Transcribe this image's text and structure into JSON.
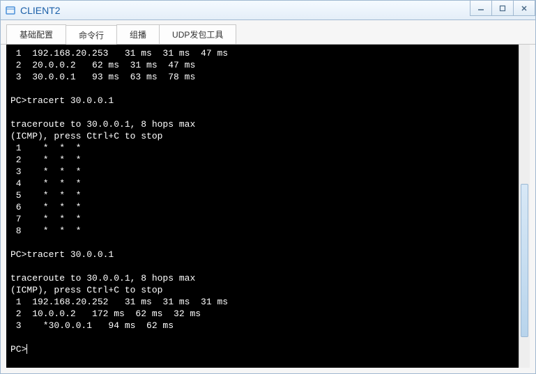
{
  "window": {
    "title": "CLIENT2",
    "icon_color": "#4a90d9"
  },
  "tabs": [
    {
      "label": "基础配置",
      "active": false
    },
    {
      "label": "命令行",
      "active": true
    },
    {
      "label": "组播",
      "active": false
    },
    {
      "label": "UDP发包工具",
      "active": false
    }
  ],
  "terminal": {
    "lines": [
      " 1  192.168.20.253   31 ms  31 ms  47 ms",
      " 2  20.0.0.2   62 ms  31 ms  47 ms",
      " 3  30.0.0.1   93 ms  63 ms  78 ms",
      "",
      "PC>tracert 30.0.0.1",
      "",
      "traceroute to 30.0.0.1, 8 hops max",
      "(ICMP), press Ctrl+C to stop",
      " 1    *  *  *",
      " 2    *  *  *",
      " 3    *  *  *",
      " 4    *  *  *",
      " 5    *  *  *",
      " 6    *  *  *",
      " 7    *  *  *",
      " 8    *  *  *",
      "",
      "PC>tracert 30.0.0.1",
      "",
      "traceroute to 30.0.0.1, 8 hops max",
      "(ICMP), press Ctrl+C to stop",
      " 1  192.168.20.252   31 ms  31 ms  31 ms",
      " 2  10.0.0.2   172 ms  62 ms  32 ms",
      " 3    *30.0.0.1   94 ms  62 ms",
      ""
    ],
    "prompt": "PC>"
  },
  "controls": {
    "minimize": "—",
    "maximize": "□",
    "close": "X"
  }
}
